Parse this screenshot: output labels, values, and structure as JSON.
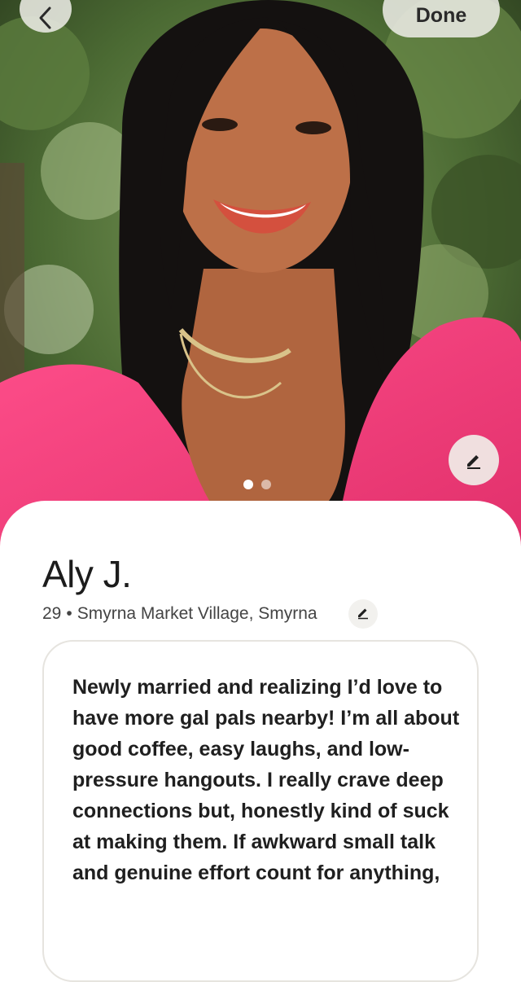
{
  "header": {
    "back_icon": "chevron-left-icon",
    "done_label": "Done"
  },
  "photo": {
    "edit_icon": "pencil-icon",
    "page_count": 2,
    "active_page": 1
  },
  "profile": {
    "name": "Aly J.",
    "age": "29",
    "separator": "•",
    "location": "Smyrna Market Village, Smyrna",
    "edit_icon": "pencil-icon",
    "bio": "Newly married and realizing I’d love to have more gal pals nearby! I’m all about good coffee, easy laughs, and low-pressure hangouts. I really crave deep connections but, honestly kind of suck at making them. If awkward small talk and genuine effort count for anything,"
  },
  "colors": {
    "accent_pink": "#f0457a",
    "foliage": "#3f5a2c",
    "text_dark": "#1c1c1c"
  }
}
